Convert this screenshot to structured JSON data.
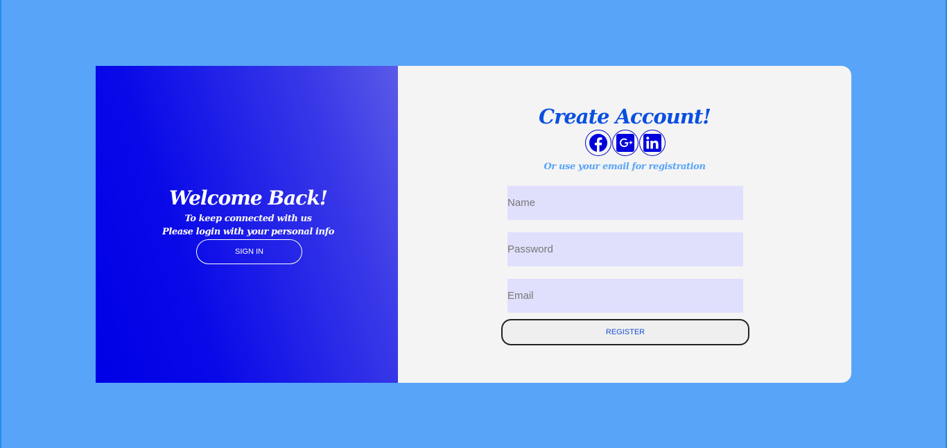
{
  "left_panel": {
    "title": "Welcome Back!",
    "subtitle_line1": "To keep connected with us",
    "subtitle_line2": "Please login with your personal info",
    "signin_label": "SIGN IN"
  },
  "right_panel": {
    "title": "Create Account!",
    "socials": [
      {
        "icon": "facebook-icon"
      },
      {
        "icon": "google-plus-icon"
      },
      {
        "icon": "linkedin-icon"
      }
    ],
    "registration_note": "Or use your email for registration",
    "fields": {
      "name_placeholder": "Name",
      "password_placeholder": "Password",
      "email_placeholder": "Email"
    },
    "register_label": "REGISTER"
  },
  "colors": {
    "page_background": "#58a4f9",
    "gradient_start": "#0000e6",
    "gradient_end": "#5a5ae8",
    "title_blue": "#0a4fe0",
    "input_background": "#e0e0fd",
    "icon_blue": "#0000cc"
  }
}
